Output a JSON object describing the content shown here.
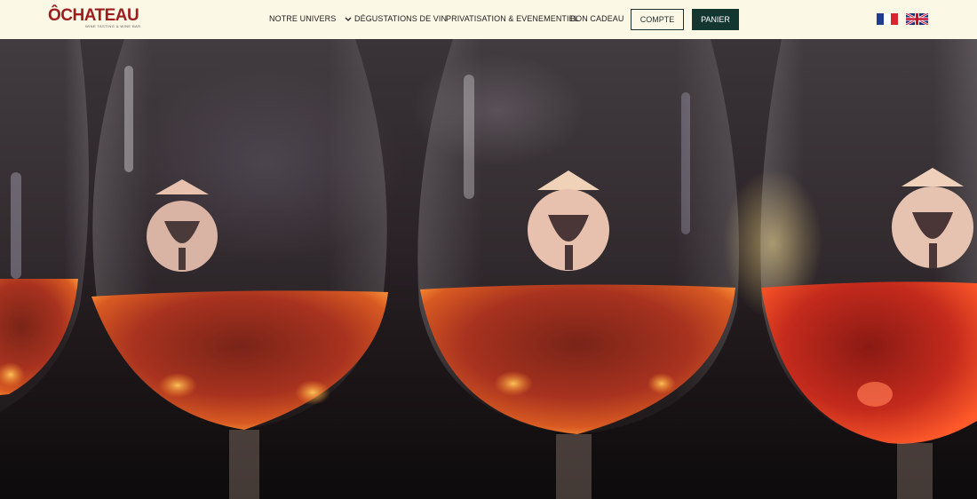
{
  "header": {
    "logo": {
      "brand": "ÔCHATEAU",
      "tagline": "WINE TASTING & WINE BAR"
    },
    "nav": [
      {
        "label": "NOTRE UNIVERS",
        "dropdown": true,
        "icon": "chevron-down-icon"
      },
      {
        "label": "DÉGUSTATIONS DE VIN"
      },
      {
        "label": "PRIVATISATION & EVENEMENTIEL"
      },
      {
        "label": "BON CADEAU"
      }
    ],
    "account_label": "COMPTE",
    "cart_label": "PANIER",
    "languages": [
      {
        "name": "french-flag-icon",
        "lang": "fr"
      },
      {
        "name": "uk-flag-icon",
        "lang": "en"
      }
    ]
  },
  "hero": {
    "image": "wine-glasses-with-ochateau-logo",
    "colors": {
      "wine": "#b8321e",
      "glow": "#ffb04a",
      "header_bg": "#fcf8e6",
      "button_dark": "#143631",
      "brand_red": "#9e1b1e"
    }
  }
}
